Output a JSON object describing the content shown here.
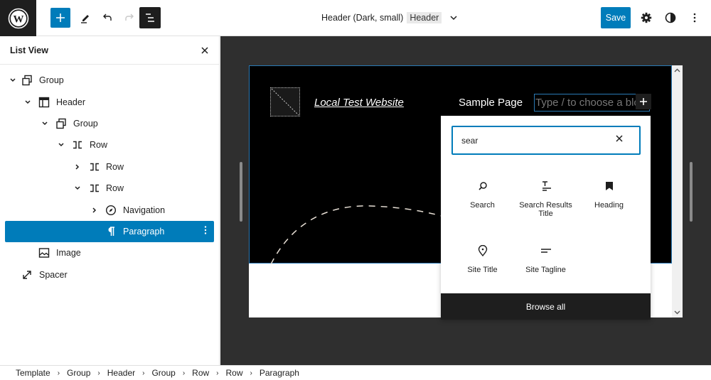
{
  "header": {
    "doc_title": "Header (Dark, small)",
    "doc_tag": "Header",
    "save_label": "Save",
    "icons": [
      "wordpress-logo",
      "plus-icon",
      "pencil-icon",
      "undo-icon",
      "redo-icon",
      "list-view-icon",
      "chevron-down-icon",
      "gear-icon",
      "contrast-icon",
      "more-vertical-icon"
    ]
  },
  "sidebar": {
    "title": "List View",
    "items": [
      {
        "label": "Group",
        "icon": "group-icon",
        "toggle": "down",
        "depth": 0
      },
      {
        "label": "Header",
        "icon": "template-part-icon",
        "toggle": "down",
        "depth": 1
      },
      {
        "label": "Group",
        "icon": "group-icon",
        "toggle": "down",
        "depth": 2
      },
      {
        "label": "Row",
        "icon": "row-icon",
        "toggle": "down",
        "depth": 3
      },
      {
        "label": "Row",
        "icon": "row-icon",
        "toggle": "right",
        "depth": 4
      },
      {
        "label": "Row",
        "icon": "row-icon",
        "toggle": "down",
        "depth": 4
      },
      {
        "label": "Navigation",
        "icon": "navigation-icon",
        "toggle": "right",
        "depth": 5
      },
      {
        "label": "Paragraph",
        "icon": "paragraph-icon",
        "toggle": "none",
        "depth": 5,
        "selected": true
      },
      {
        "label": "Image",
        "icon": "image-icon",
        "toggle": "none",
        "depth": 1
      },
      {
        "label": "Spacer",
        "icon": "spacer-icon",
        "toggle": "none",
        "depth": 0
      }
    ]
  },
  "canvas": {
    "site_name": "Local Test Website",
    "nav_item": "Sample Page",
    "paragraph_placeholder": "Type / to choose a block"
  },
  "inserter": {
    "search_value": "sear",
    "blocks": [
      {
        "label": "Search",
        "icon": "search-icon"
      },
      {
        "label": "Search Results Title",
        "icon": "title-icon"
      },
      {
        "label": "Heading",
        "icon": "bookmark-icon"
      },
      {
        "label": "Site Title",
        "icon": "map-marker-icon"
      },
      {
        "label": "Site Tagline",
        "icon": "tagline-icon"
      }
    ],
    "browse_all": "Browse all"
  },
  "breadcrumb": [
    "Template",
    "Group",
    "Header",
    "Group",
    "Row",
    "Row",
    "Paragraph"
  ],
  "colors": {
    "accent": "#007cba",
    "dark": "#1e1e1e",
    "canvas_bg": "#2f2f2f"
  }
}
